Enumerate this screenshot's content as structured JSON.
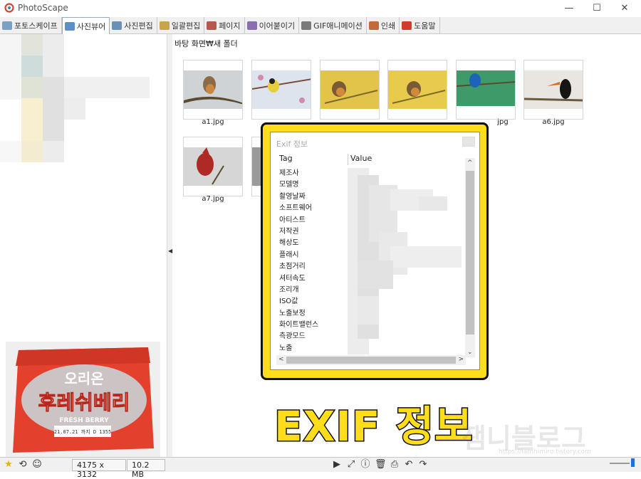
{
  "window": {
    "title": "PhotoScape",
    "minimize_icon": "minimize-icon",
    "maximize_icon": "maximize-icon",
    "close_icon": "close-icon"
  },
  "tabs": [
    {
      "label": "포토스케이프",
      "icon": "photoscape-icon",
      "color": "#7aa0c4",
      "active": false
    },
    {
      "label": "사진뷰어",
      "icon": "viewer-icon",
      "color": "#5b8fc7",
      "active": true
    },
    {
      "label": "사진편집",
      "icon": "editor-icon",
      "color": "#6a8fb8",
      "active": false
    },
    {
      "label": "일괄편집",
      "icon": "batch-icon",
      "color": "#c9a548",
      "active": false
    },
    {
      "label": "페이지",
      "icon": "page-icon",
      "color": "#b55a4a",
      "active": false
    },
    {
      "label": "이어붙이기",
      "icon": "combine-icon",
      "color": "#8a6fb0",
      "active": false
    },
    {
      "label": "GIF애니메이션",
      "icon": "gif-icon",
      "color": "#7a7a7a",
      "active": false
    },
    {
      "label": "인쇄",
      "icon": "print-icon",
      "color": "#c46a3a",
      "active": false
    },
    {
      "label": "도움말",
      "icon": "help-icon",
      "color": "#d23a2a",
      "active": false
    }
  ],
  "path": "바탕 화면₩새 폴더",
  "thumbnails": [
    {
      "label": "a1.jpg"
    },
    {
      "label": ""
    },
    {
      "label": ""
    },
    {
      "label": ""
    },
    {
      "label": "jpg"
    },
    {
      "label": "a6.jpg"
    },
    {
      "label": "a7.jpg"
    },
    {
      "label": ""
    }
  ],
  "exif": {
    "title": "Exif 정보",
    "col_tag": "Tag",
    "col_value": "Value",
    "rows": [
      "제조사",
      "모델명",
      "촬영날짜",
      "소프트웨어",
      "아티스트",
      "저작권",
      "해상도",
      "플래시",
      "초점거리",
      "셔터속도",
      "조리개",
      "ISO값",
      "노출보정",
      "화이트밸런스",
      "측광모드",
      "노출"
    ]
  },
  "preview": {
    "line1": "오리온",
    "line2": "후레쉬베리",
    "line3": "FRESH BERRY",
    "line4": "21.07.21 까지 D 1355"
  },
  "big_label": "EXIF 정보",
  "watermark": {
    "text": "잼니블로그",
    "url": "https://iamhimiro.tistory.com"
  },
  "status": {
    "dimensions": "4175 x 3132",
    "filesize": "10.2 MB"
  }
}
